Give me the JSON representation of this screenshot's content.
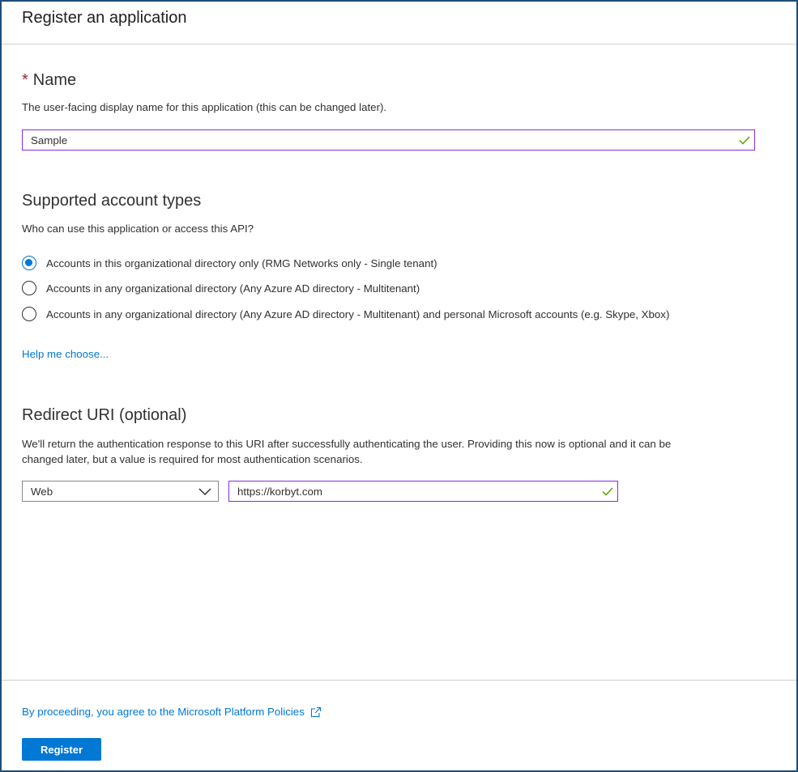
{
  "page": {
    "title": "Register an application"
  },
  "name_section": {
    "required_marker": "*",
    "title": "Name",
    "description": "The user-facing display name for this application (this can be changed later).",
    "input_value": "Sample"
  },
  "account_section": {
    "title": "Supported account types",
    "description": "Who can use this application or access this API?",
    "options": [
      {
        "label": "Accounts in this organizational directory only (RMG Networks only - Single tenant)",
        "selected": true
      },
      {
        "label": "Accounts in any organizational directory (Any Azure AD directory - Multitenant)",
        "selected": false
      },
      {
        "label": "Accounts in any organizational directory (Any Azure AD directory - Multitenant) and personal Microsoft accounts (e.g. Skype, Xbox)",
        "selected": false
      }
    ],
    "help_link": "Help me choose..."
  },
  "redirect_section": {
    "title": "Redirect URI (optional)",
    "description_line1": "We'll return the authentication response to this URI after successfully authenticating the user. Providing this now is optional and it can be",
    "description_line2": "changed later, but a value is required for most authentication scenarios.",
    "platform_value": "Web",
    "uri_value": "https://korbyt.com"
  },
  "footer": {
    "policy_text": "By proceeding, you agree to the Microsoft Platform Policies",
    "register_label": "Register"
  },
  "colors": {
    "accent": "#0078d4",
    "input_border_valid": "#8a2be2",
    "check": "#57a300",
    "required": "#a4262c"
  },
  "icons": {
    "valid": "check-icon",
    "dropdown": "chevron-down-icon",
    "external": "external-link-icon"
  }
}
